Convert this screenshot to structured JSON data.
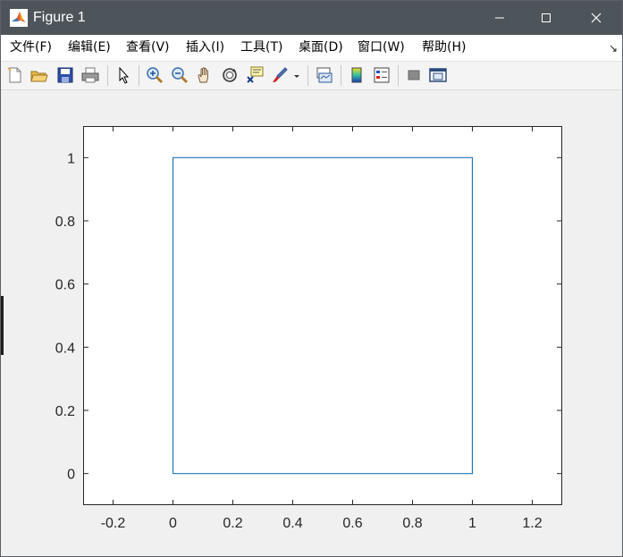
{
  "window": {
    "title": "Figure 1",
    "minimize_glyph": "—",
    "maximize_glyph": "☐",
    "close_glyph": "✕"
  },
  "menu": {
    "items": [
      {
        "label": "文件(F)"
      },
      {
        "label": "编辑(E)"
      },
      {
        "label": "查看(V)"
      },
      {
        "label": "插入(I)"
      },
      {
        "label": "工具(T)"
      },
      {
        "label": "桌面(D)"
      },
      {
        "label": "窗口(W)"
      },
      {
        "label": "帮助(H)"
      }
    ],
    "dock_arrow": "↘"
  },
  "toolbar": {
    "icons": [
      "new-figure-icon",
      "open-file-icon",
      "save-icon",
      "print-icon",
      "edit-plot-cursor-icon",
      "zoom-in-icon",
      "zoom-out-icon",
      "pan-hand-icon",
      "rotate-3d-icon",
      "data-cursor-icon",
      "brush-icon",
      "brush-dropdown-icon",
      "link-plot-icon",
      "colorbar-icon",
      "legend-icon",
      "hide-plot-tools-icon",
      "show-plot-tools-icon"
    ]
  },
  "colors": {
    "line": "#1f77b4",
    "axes_background": "#ffffff",
    "figure_background": "#f0f0f0",
    "titlebar": "#4d555b"
  },
  "chart_data": {
    "type": "line",
    "series": [
      {
        "x": [
          0,
          1,
          1,
          0,
          0
        ],
        "y": [
          0,
          0,
          1,
          1,
          0
        ]
      }
    ],
    "xlim": [
      -0.3,
      1.3
    ],
    "ylim": [
      -0.1,
      1.1
    ],
    "xticks": [
      -0.2,
      0,
      0.2,
      0.4,
      0.6,
      0.8,
      1,
      1.2
    ],
    "xtick_labels": [
      "-0.2",
      "0",
      "0.2",
      "0.4",
      "0.6",
      "0.8",
      "1",
      "1.2"
    ],
    "yticks": [
      0,
      0.2,
      0.4,
      0.6,
      0.8,
      1
    ],
    "ytick_labels": [
      "0",
      "0.2",
      "0.4",
      "0.6",
      "0.8",
      "1"
    ],
    "grid": false,
    "box": true
  }
}
